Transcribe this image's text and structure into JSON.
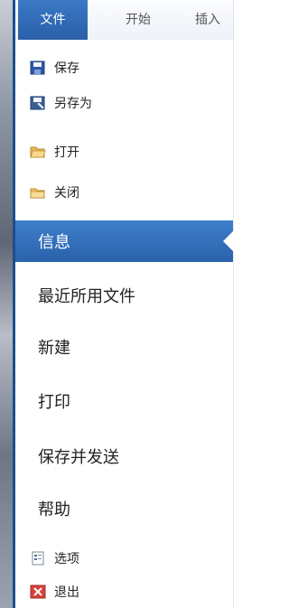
{
  "tabs": [
    {
      "label": "文件"
    },
    {
      "label": "开始"
    },
    {
      "label": "插入"
    }
  ],
  "menu": {
    "quick_items": [
      {
        "label": "保存",
        "icon": "save-icon"
      },
      {
        "label": "另存为",
        "icon": "save-as-icon"
      },
      {
        "label": "打开",
        "icon": "open-folder-icon"
      },
      {
        "label": "关闭",
        "icon": "close-folder-icon"
      }
    ],
    "main_items": [
      {
        "label": "信息",
        "selected": true
      },
      {
        "label": "最近所用文件"
      },
      {
        "label": "新建"
      },
      {
        "label": "打印"
      },
      {
        "label": "保存并发送"
      },
      {
        "label": "帮助"
      }
    ],
    "bottom_items": [
      {
        "label": "选项",
        "icon": "options-icon"
      },
      {
        "label": "退出",
        "icon": "exit-icon"
      }
    ]
  },
  "colors": {
    "accent": "#2b5fa8",
    "selected": "#3f7fcb"
  }
}
